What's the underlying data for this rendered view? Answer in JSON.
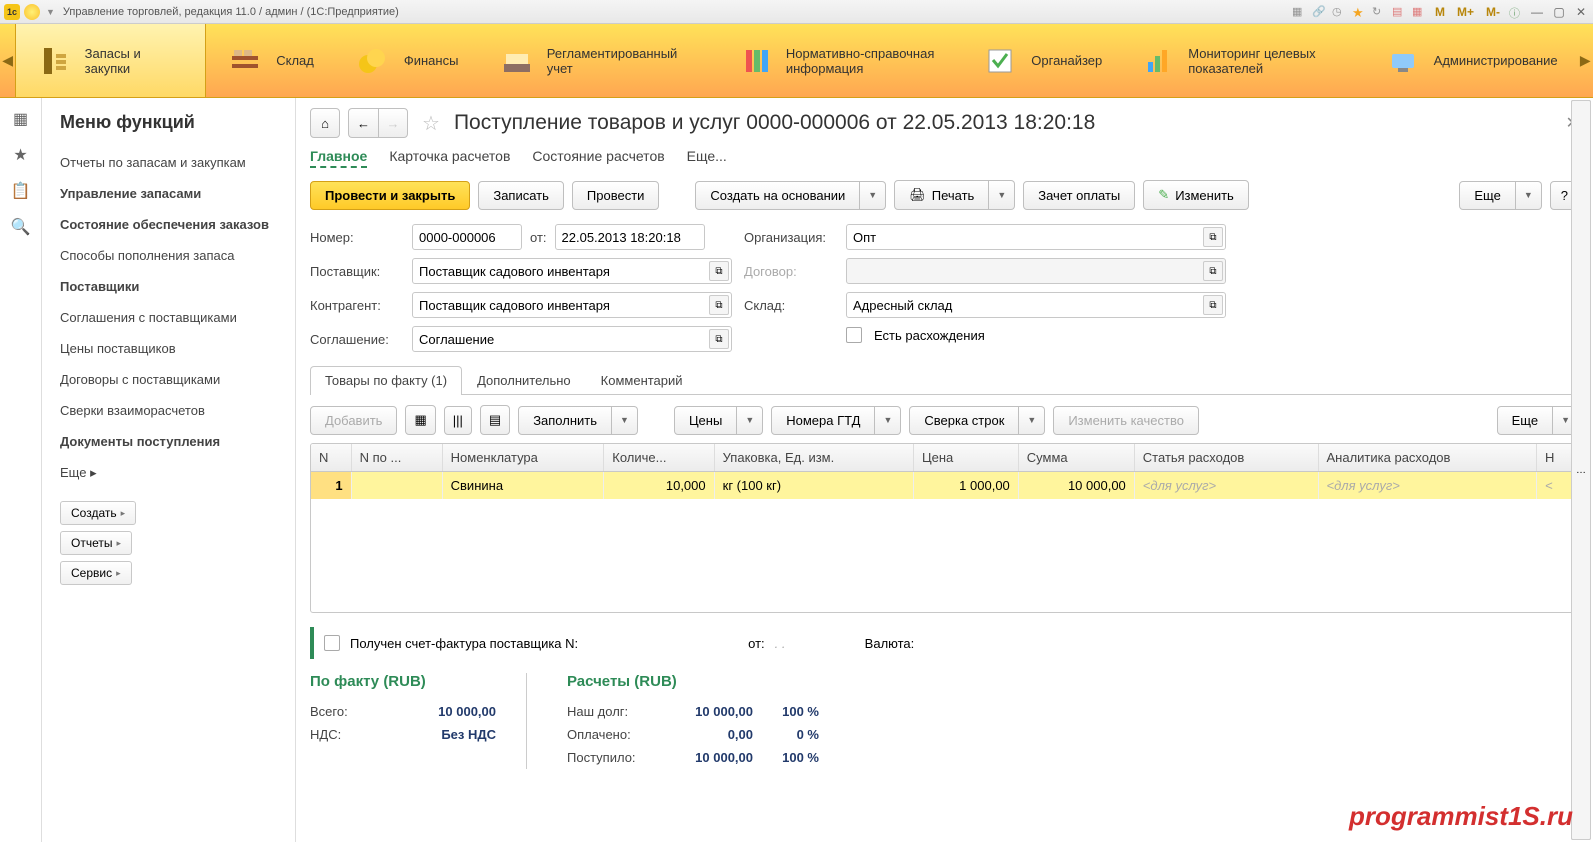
{
  "titlebar": {
    "breadcrumb": "Управление торговлей, редакция 11.0 / админ /   (1С:Предприятие)",
    "m_buttons": [
      "M",
      "M+",
      "M-"
    ]
  },
  "ribbon": {
    "items": [
      {
        "label": "Запасы и закупки",
        "active": true
      },
      {
        "label": "Склад"
      },
      {
        "label": "Финансы"
      },
      {
        "label": "Регламентированный учет"
      },
      {
        "label": "Нормативно-справочная информация"
      },
      {
        "label": "Органайзер"
      },
      {
        "label": "Мониторинг целевых показателей"
      },
      {
        "label": "Администрирование"
      }
    ]
  },
  "func_menu": {
    "title": "Меню функций",
    "items": [
      {
        "label": "Отчеты по запасам и закупкам"
      },
      {
        "label": "Управление запасами",
        "bold": true
      },
      {
        "label": "Состояние обеспечения заказов",
        "bold": true
      },
      {
        "label": "Способы пополнения запаса"
      },
      {
        "label": "Поставщики",
        "bold": true
      },
      {
        "label": "Соглашения с поставщиками"
      },
      {
        "label": "Цены поставщиков"
      },
      {
        "label": "Договоры с поставщиками"
      },
      {
        "label": "Сверки взаиморасчетов"
      },
      {
        "label": "Документы поступления",
        "bold": true
      }
    ],
    "more": "Еще ▸",
    "buttons": [
      "Создать",
      "Отчеты",
      "Сервис"
    ]
  },
  "doc": {
    "title": "Поступление товаров и услуг 0000-000006 от 22.05.2013 18:20:18",
    "tabs": [
      "Главное",
      "Карточка расчетов",
      "Состояние расчетов",
      "Еще..."
    ],
    "cmd": {
      "post_close": "Провести и закрыть",
      "save": "Записать",
      "post": "Провести",
      "create_based": "Создать на основании",
      "print": "Печать",
      "offset": "Зачет оплаты",
      "edit": "Изменить",
      "more": "Еще",
      "help": "?"
    },
    "fields": {
      "number_lbl": "Номер:",
      "number": "0000-000006",
      "date_lbl": "от:",
      "date": "22.05.2013 18:20:18",
      "org_lbl": "Организация:",
      "org": "Опт",
      "supplier_lbl": "Поставщик:",
      "supplier": "Поставщик садового инвентаря",
      "contract_lbl": "Договор:",
      "contract": "",
      "counterparty_lbl": "Контрагент:",
      "counterparty": "Поставщик садового инвентаря",
      "warehouse_lbl": "Склад:",
      "warehouse": "Адресный склад",
      "agreement_lbl": "Соглашение:",
      "agreement": "Соглашение",
      "differs_lbl": "Есть расхождения"
    },
    "inner_tabs": [
      "Товары по факту (1)",
      "Дополнительно",
      "Комментарий"
    ],
    "table_cmd": {
      "add": "Добавить",
      "fill": "Заполнить",
      "prices": "Цены",
      "gtd": "Номера ГТД",
      "reconcile": "Сверка строк",
      "quality": "Изменить качество",
      "more": "Еще"
    },
    "table": {
      "headers": [
        "N",
        "N по ...",
        "Номенклатура",
        "Количе...",
        "Упаковка, Ед. изм.",
        "Цена",
        "Сумма",
        "Статья расходов",
        "Аналитика расходов",
        "Н"
      ],
      "rows": [
        {
          "n": "1",
          "npo": "",
          "nomenclature": "Свинина",
          "qty": "10,000",
          "pack": "кг (100 кг)",
          "price": "1 000,00",
          "sum": "10 000,00",
          "exp_item": "<для услуг>",
          "exp_anl": "<для услуг>"
        }
      ]
    },
    "invoice": {
      "label": "Получен счет-фактура поставщика N:",
      "date_lbl": "от:",
      "date_placeholder": ".  .",
      "currency_lbl": "Валюта:"
    },
    "totals": {
      "fact_title": "По факту (RUB)",
      "calc_title": "Расчеты (RUB)",
      "rows_fact": [
        {
          "l": "Всего:",
          "v": "10 000,00"
        },
        {
          "l": "НДС:",
          "v": "Без НДС"
        }
      ],
      "rows_calc": [
        {
          "l": "Наш долг:",
          "v": "10 000,00",
          "p": "100 %"
        },
        {
          "l": "Оплачено:",
          "v": "0,00",
          "p": "0 %"
        },
        {
          "l": "Поступило:",
          "v": "10 000,00",
          "p": "100 %"
        }
      ]
    }
  },
  "watermark": "programmist1S.ru"
}
